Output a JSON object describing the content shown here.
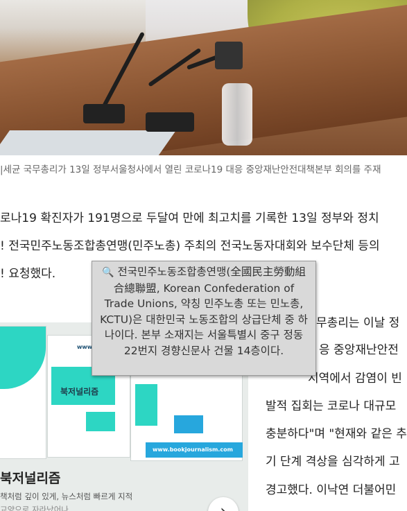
{
  "caption": "|세균 국무총리가 13일 정부서울청사에서 열린 코로나19 대응 중앙재난안전대책본부 회의를 주재",
  "article": {
    "line1": "로나19 확진자가 191명으로 두달여 만에 최고치를 기록한 13일 정부와 정치",
    "line2": "! 전국민주노동조합총연맹(민주노총) 주최의 전국노동자대회와 보수단체 등의",
    "line3": "! 요청했다.",
    "right_lines": [
      "무총리는 이날 정",
      "응 중앙재난안전",
      "지역에서 감염이 빈",
      "발적 집회는 코로나 대규모",
      "충분하다\"며 \"현재와 같은 추",
      "기 단계 격상을 심각하게 고",
      "경고했다. 이낙연 더불어민"
    ]
  },
  "tooltip": {
    "icon": "🔍",
    "text": "전국민주노동조합총연맹(全國民主勞動組合總聯盟, Korean Confederation of Trade Unions, 약칭 민주노총 또는 민노총, KCTU)은 대한민국 노동조합의 상급단체 중 하나이다. 본부 소재지는 서울특별시 중구 정동 22번지 경향신문사 건물 14층이다."
  },
  "ad": {
    "title": "북저널리즘",
    "subtitle": "책처럼 깊이 있게, 뉴스처럼 빠르게 지적",
    "subtitle2": "교양으로 자라났어나",
    "book_label": "북저널리즘",
    "url": "www.bookjournalism.com",
    "url_short": "www.b",
    "next_icon": "›"
  },
  "colors": {
    "teal": "#2dd6c3",
    "blue": "#27a7dd",
    "tooltip_bg": "#d9d9d9"
  }
}
